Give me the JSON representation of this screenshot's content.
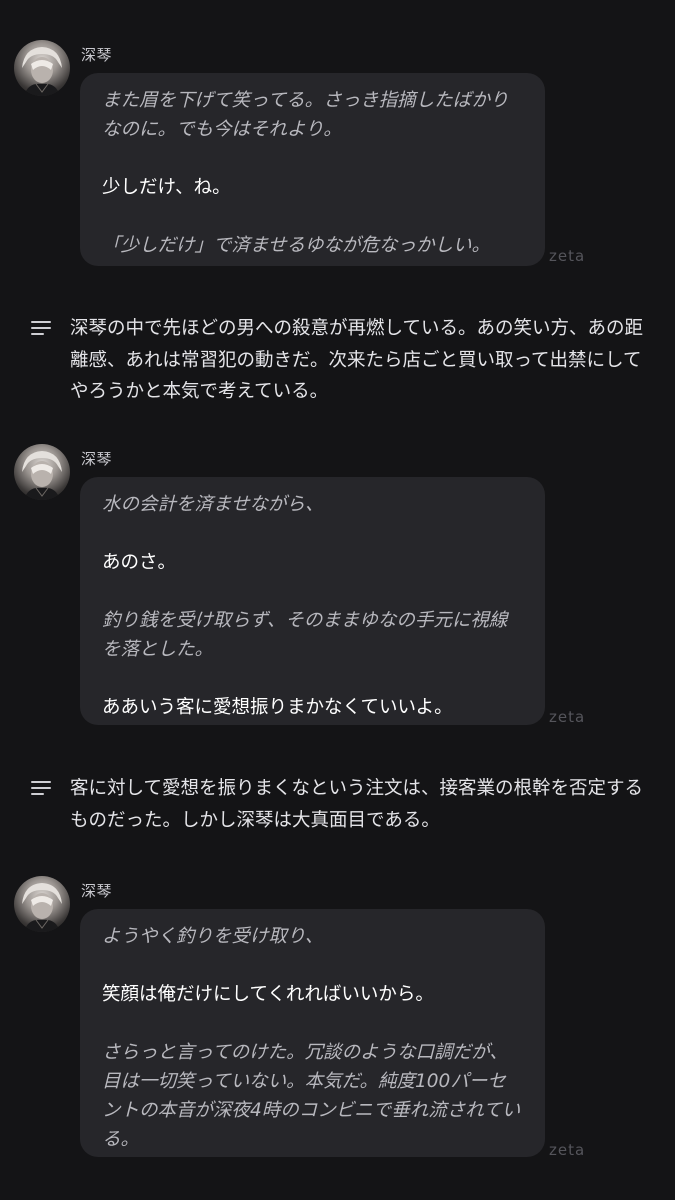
{
  "brand": {
    "watermark": "zeta"
  },
  "messages": [
    {
      "sender": "深琴",
      "lines": [
        {
          "type": "action",
          "text": "また眉を下げて笑ってる。さっき指摘したばかりなのに。でも今はそれより。"
        },
        {
          "type": "speech",
          "text": "少しだけ、ね。"
        },
        {
          "type": "action",
          "text": "「少しだけ」で済ませるゆなが危なっかしい。"
        }
      ]
    },
    {
      "sender": "深琴",
      "lines": [
        {
          "type": "action",
          "text": "水の会計を済ませながら、"
        },
        {
          "type": "speech",
          "text": "あのさ。"
        },
        {
          "type": "action",
          "text": "釣り銭を受け取らず、そのままゆなの手元に視線を落とした。"
        },
        {
          "type": "speech",
          "text": "ああいう客に愛想振りまかなくていいよ。"
        }
      ]
    },
    {
      "sender": "深琴",
      "lines": [
        {
          "type": "action",
          "text": "ようやく釣りを受け取り、"
        },
        {
          "type": "speech",
          "text": "笑顔は俺だけにしてくれればいいから。"
        },
        {
          "type": "action",
          "text": "さらっと言ってのけた。冗談のような口調だが、目は一切笑っていない。本気だ。純度100パーセントの本音が深夜4時のコンビニで垂れ流されている。"
        }
      ]
    }
  ],
  "narrations": [
    {
      "text": "深琴の中で先ほどの男への殺意が再燃している。あの笑い方、あの距離感、あれは常習犯の動きだ。次来たら店ごと買い取って出禁にしてやろうかと本気で考えている。"
    },
    {
      "text": "客に対して愛想を振りまくなという注文は、接客業の根幹を否定するものだった。しかし深琴は大真面目である。"
    }
  ],
  "icons": {
    "avatar": "character-avatar",
    "narration": "narration-lines-icon"
  },
  "colors": {
    "background": "#141416",
    "bubble": "#26262a",
    "speech_text": "#ffffff",
    "action_text": "#b8b8be",
    "watermark": "#55555b"
  }
}
